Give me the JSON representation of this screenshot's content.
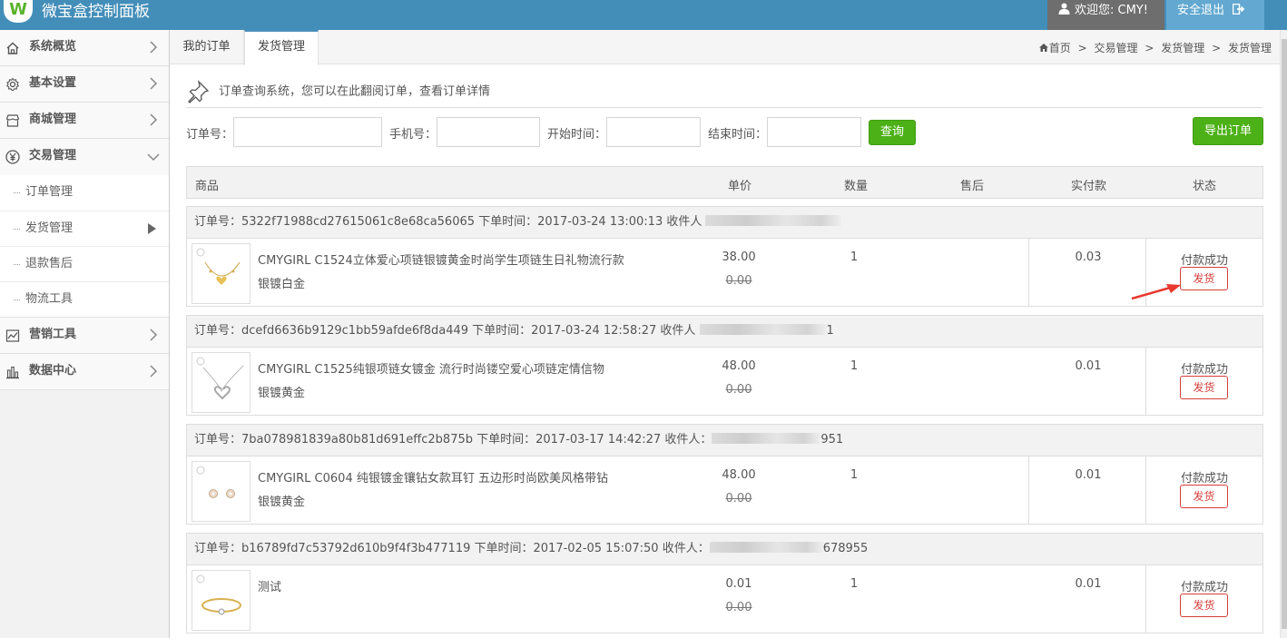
{
  "header": {
    "app_title": "微宝盒控制面板",
    "logo_text": "W",
    "welcome": "欢迎您: CMY!",
    "logout": "安全退出"
  },
  "sidebar": {
    "items": [
      {
        "label": "系统概览",
        "icon": "home-icon"
      },
      {
        "label": "基本设置",
        "icon": "gear-icon"
      },
      {
        "label": "商城管理",
        "icon": "store-icon"
      },
      {
        "label": "交易管理",
        "icon": "yen-icon"
      },
      {
        "label": "营销工具",
        "icon": "chart-line-icon"
      },
      {
        "label": "数据中心",
        "icon": "bar-chart-icon"
      }
    ],
    "subitems": [
      {
        "label": "订单管理"
      },
      {
        "label": "发货管理"
      },
      {
        "label": "退款售后"
      },
      {
        "label": "物流工具"
      }
    ]
  },
  "tabs": [
    {
      "label": "我的订单"
    },
    {
      "label": "发货管理"
    }
  ],
  "breadcrumb": {
    "items": [
      "首页",
      "交易管理",
      "发货管理",
      "发货管理"
    ],
    "separator": ">"
  },
  "notice": "订单查询系统，您可以在此翻阅订单，查看订单详情",
  "filters": {
    "order_no_label": "订单号：",
    "phone_label": "手机号：",
    "start_label": "开始时间：",
    "end_label": "结束时间：",
    "query_button": "查询",
    "export_button": "导出订单"
  },
  "table": {
    "headers": [
      "商品",
      "单价",
      "数量",
      "售后",
      "实付款",
      "状态"
    ]
  },
  "orders": [
    {
      "head_prefix": "订单号：5322f71988cd27615061c8e68ca56065 下单时间：2017-03-24 13:00:13 收件人",
      "head_suffix": "",
      "product_name": "CMYGIRL C1524立体爱心项链银镀黄金时尚学生项链生日礼物流行款",
      "spec": "银镀白金",
      "price": "38.00",
      "original_price": "0.00",
      "quantity": "1",
      "paid": "0.03",
      "status": "付款成功",
      "action": "发货"
    },
    {
      "head_prefix": "订单号：dcefd6636b9129c1bb59afde6f8da449 下单时间：2017-03-24 12:58:27 收件人",
      "head_suffix": "1",
      "product_name": "CMYGIRL C1525纯银项链女镀金 流行时尚镂空爱心项链定情信物",
      "spec": "银镀黄金",
      "price": "48.00",
      "original_price": "0.00",
      "quantity": "1",
      "paid": "0.01",
      "status": "付款成功",
      "action": "发货"
    },
    {
      "head_prefix": "订单号：7ba078981839a80b81d691effc2b875b 下单时间：2017-03-17 14:42:27 收件人：",
      "head_suffix": "951",
      "product_name": "CMYGIRL C0604 纯银镀金镶钻女款耳钉 五边形时尚欧美风格带钻",
      "spec": "银镀黄金",
      "price": "48.00",
      "original_price": "0.00",
      "quantity": "1",
      "paid": "0.01",
      "status": "付款成功",
      "action": "发货"
    },
    {
      "head_prefix": "订单号：b16789fd7c53792d610b9f4f3b477119 下单时间：2017-02-05 15:07:50 收件人：",
      "head_suffix": "678955",
      "product_name": "测试",
      "spec": "",
      "price": "0.01",
      "original_price": "0.00",
      "quantity": "1",
      "paid": "0.01",
      "status": "付款成功",
      "action": "发货"
    }
  ],
  "colors": {
    "header_bg": "#438eb9",
    "welcome_bg": "#6e6e6e",
    "logout_bg": "#62a8d1",
    "green_button": "#4cb117",
    "ship_button": "#d43f3a",
    "arrow": "#e8392f"
  }
}
